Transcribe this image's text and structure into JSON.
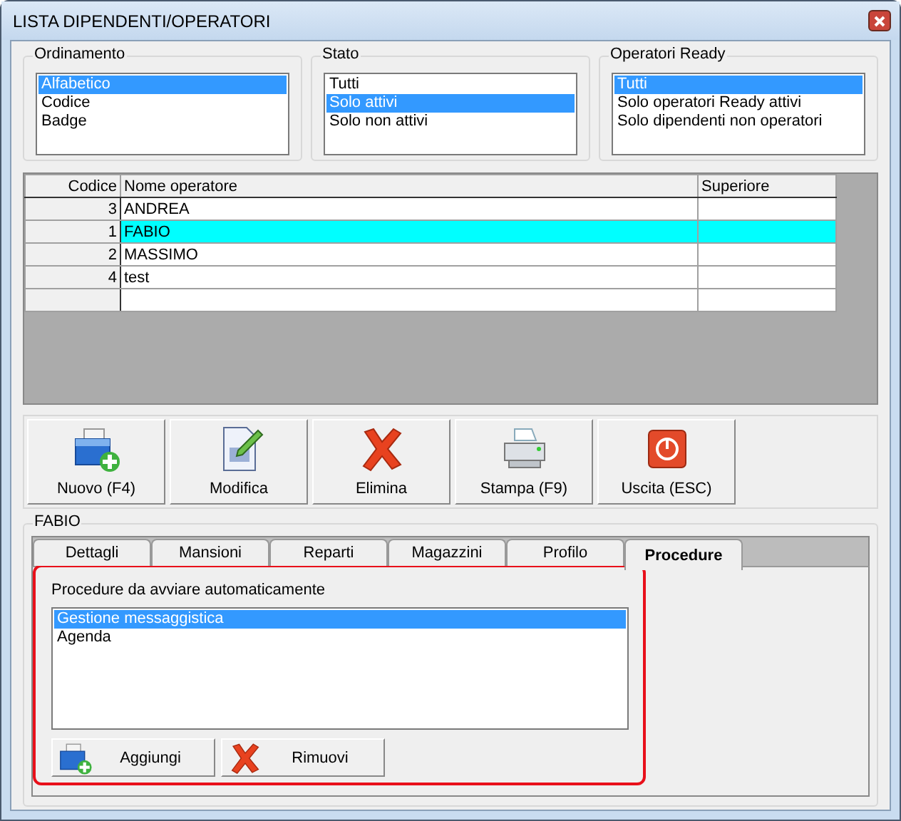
{
  "window": {
    "title": "LISTA DIPENDENTI/OPERATORI"
  },
  "filters": [
    {
      "title": "Ordinamento",
      "items": [
        {
          "label": "Alfabetico",
          "selected": true
        },
        {
          "label": "Codice",
          "selected": false
        },
        {
          "label": "Badge",
          "selected": false
        }
      ]
    },
    {
      "title": "Stato",
      "items": [
        {
          "label": "Tutti",
          "selected": false
        },
        {
          "label": "Solo attivi",
          "selected": true
        },
        {
          "label": "Solo non attivi",
          "selected": false
        }
      ]
    },
    {
      "title": "Operatori Ready",
      "items": [
        {
          "label": "Tutti",
          "selected": true
        },
        {
          "label": "Solo operatori Ready attivi",
          "selected": false
        },
        {
          "label": "Solo dipendenti non operatori",
          "selected": false
        }
      ]
    }
  ],
  "table": {
    "columns": [
      "Codice",
      "Nome operatore",
      "Superiore"
    ],
    "rows": [
      {
        "codice": "3",
        "nome": "ANDREA",
        "selected": false
      },
      {
        "codice": "1",
        "nome": "FABIO",
        "selected": true
      },
      {
        "codice": "2",
        "nome": "MASSIMO",
        "selected": false
      },
      {
        "codice": "4",
        "nome": "test",
        "selected": false
      }
    ]
  },
  "toolbar": [
    {
      "label": "Nuovo (F4)",
      "kind": "new"
    },
    {
      "label": "Modifica",
      "kind": "edit"
    },
    {
      "label": "Elimina",
      "kind": "delete"
    },
    {
      "label": "Stampa (F9)",
      "kind": "print"
    },
    {
      "label": "Uscita (ESC)",
      "kind": "exit"
    }
  ],
  "detail": {
    "title": "FABIO",
    "tabs": [
      {
        "label": "Dettagli",
        "selected": false
      },
      {
        "label": "Mansioni",
        "selected": false
      },
      {
        "label": "Reparti",
        "selected": false
      },
      {
        "label": "Magazzini",
        "selected": false
      },
      {
        "label": "Profilo",
        "selected": false
      },
      {
        "label": "Procedure",
        "selected": true
      }
    ],
    "panel_label": "Procedure da avviare automaticamente",
    "procedures": [
      {
        "label": "Gestione messaggistica",
        "selected": true
      },
      {
        "label": "Agenda",
        "selected": false
      }
    ],
    "buttons": [
      {
        "label": "Aggiungi",
        "kind": "new"
      },
      {
        "label": "Rimuovi",
        "kind": "delete"
      }
    ]
  }
}
